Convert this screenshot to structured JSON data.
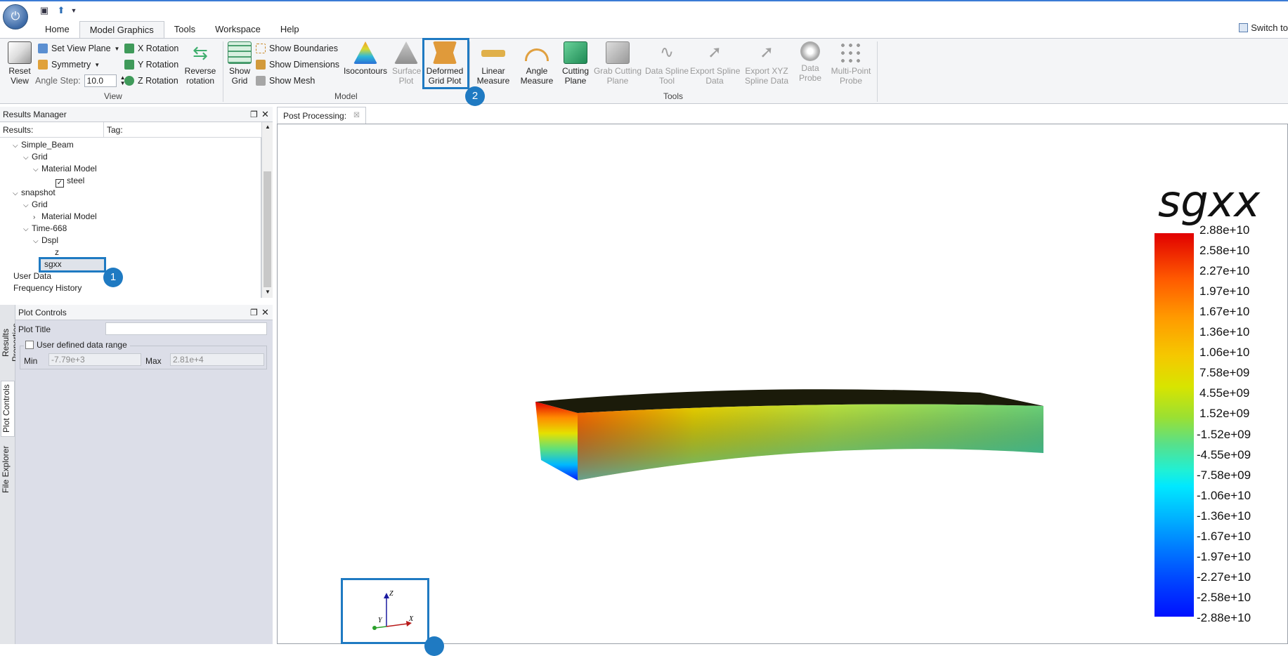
{
  "quick_access": {
    "app_icon": "power-icon",
    "save_icon": "save-icon",
    "export_icon": "export-icon",
    "dropdown_icon": "chevron-down-icon"
  },
  "menu": {
    "tabs": [
      "Home",
      "Model Graphics",
      "Tools",
      "Workspace",
      "Help"
    ],
    "switch_to": "Switch to"
  },
  "ribbon": {
    "reset_view": "Reset\nView",
    "set_view_plane": "Set View Plane",
    "symmetry": "Symmetry",
    "angle_step_label": "Angle Step:",
    "angle_step_value": "10.0",
    "x_rotation": "X Rotation",
    "y_rotation": "Y Rotation",
    "z_rotation": "Z Rotation",
    "reverse_rotation": "Reverse\nrotation",
    "view_group": "View",
    "show_grid": "Show\nGrid",
    "show_boundaries": "Show Boundaries",
    "show_dimensions": "Show Dimensions",
    "show_mesh": "Show Mesh",
    "isocontours": "Isocontours",
    "surface_plot": "Surface\nPlot",
    "deformed_grid_plot": "Deformed\nGrid Plot",
    "model_group": "Model",
    "linear_measure": "Linear\nMeasure",
    "angle_measure": "Angle\nMeasure",
    "cutting_plane": "Cutting\nPlane",
    "grab_cutting_plane": "Grab Cutting\nPlane",
    "data_spline_tool": "Data Spline\nTool",
    "export_spline_data": "Export Spline\nData",
    "export_xyz_spline_data": "Export XYZ\nSpline Data",
    "data_probe": "Data\nProbe",
    "multi_point_probe": "Multi-Point\nProbe",
    "tools_group": "Tools"
  },
  "results_manager": {
    "title": "Results Manager",
    "col_results": "Results:",
    "col_tag": "Tag:",
    "tree": {
      "simple_beam": "Simple_Beam",
      "grid1": "Grid",
      "material_model1": "Material Model",
      "steel": "steel",
      "snapshot": "snapshot",
      "grid2": "Grid",
      "material_model2": "Material Model",
      "time": "Time-668",
      "dspl": "Dspl",
      "z": "z",
      "sgxx": "sgxx",
      "user_data": "User Data",
      "frequency_history": "Frequency History"
    }
  },
  "plot_controls": {
    "title": "Plot Controls",
    "plot_title_label": "Plot Title",
    "plot_title_value": "",
    "user_defined_range": "User defined data range",
    "min_label": "Min",
    "min_value": "-7.79e+3",
    "max_label": "Max",
    "max_value": "2.81e+4"
  },
  "side_tabs": [
    "Results Properties",
    "Plot Controls",
    "File Explorer"
  ],
  "viewport": {
    "tab_label": "Post Processing:",
    "legend_title": "sgxx",
    "legend_values": [
      "2.88e+10",
      "2.58e+10",
      "2.27e+10",
      "1.97e+10",
      "1.67e+10",
      "1.36e+10",
      "1.06e+10",
      "7.58e+09",
      "4.55e+09",
      "1.52e+09",
      "-1.52e+09",
      "-4.55e+09",
      "-7.58e+09",
      "-1.06e+10",
      "-1.36e+10",
      "-1.67e+10",
      "-1.97e+10",
      "-2.27e+10",
      "-2.58e+10",
      "-2.88e+10"
    ],
    "axis_labels": {
      "z": "Z",
      "y": "Y",
      "x": "X"
    }
  },
  "annotations": {
    "badge1": "1",
    "badge2": "2"
  },
  "colors": {
    "accent": "#1f7ac2",
    "ribbon_bg": "#f4f5f7",
    "panel_bg": "#dcdee8"
  }
}
